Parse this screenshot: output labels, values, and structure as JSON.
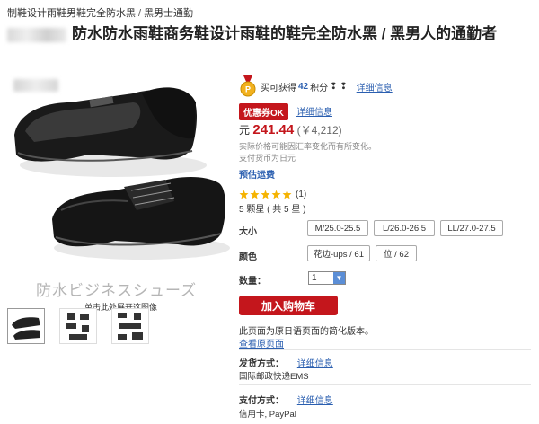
{
  "breadcrumb": {
    "item1": "制鞋设计雨鞋男鞋完全防水黑",
    "sep": "/",
    "item2": "黑男士通勤"
  },
  "title": "防水防水雨鞋商务鞋设计雨鞋的鞋完全防水黑 / 黑男人的通勤者",
  "image": {
    "watermark": "防水ビジネスシューズ",
    "enlarge": "单击此处展开这图像"
  },
  "points": {
    "prefix": "买可获得",
    "amount": "42",
    "suffix": "积分",
    "suffix_icons": "❢ ❢",
    "details": "详细信息"
  },
  "coupon": {
    "badge": "优惠券OK",
    "details": "详细信息"
  },
  "price": {
    "currency": "元",
    "amount": "241.44",
    "yen": "(￥4,212)"
  },
  "price_notes": [
    "实际价格可能因汇率变化而有所变化。",
    "支付货币为日元"
  ],
  "shipping": "预估运费",
  "rating": {
    "stars": 5,
    "count": "(1)",
    "summary": "5 颗星 ( 共 5 星 )"
  },
  "options": {
    "size_label": "大小",
    "sizes": [
      "M/25.0-25.5",
      "L/26.0-26.5",
      "LL/27.0-27.5"
    ],
    "color_label": "颜色",
    "colors": [
      "花边-ups / 61",
      "位 / 62"
    ]
  },
  "quantity": {
    "label": "数量：",
    "value": "1"
  },
  "cart_button": "加入购物车",
  "simplified_notice": "此页面为原日语页面的简化版本。",
  "view_original": "查看原页面",
  "delivery": {
    "label": "发货方式：",
    "details": "详细信息",
    "value": "国际邮政快递EMS"
  },
  "payment": {
    "label": "支付方式：",
    "details": "详细信息",
    "value": "信用卡, PayPal"
  },
  "colors": {
    "accent_red": "#c4161c",
    "link_blue": "#2b5fb0"
  }
}
